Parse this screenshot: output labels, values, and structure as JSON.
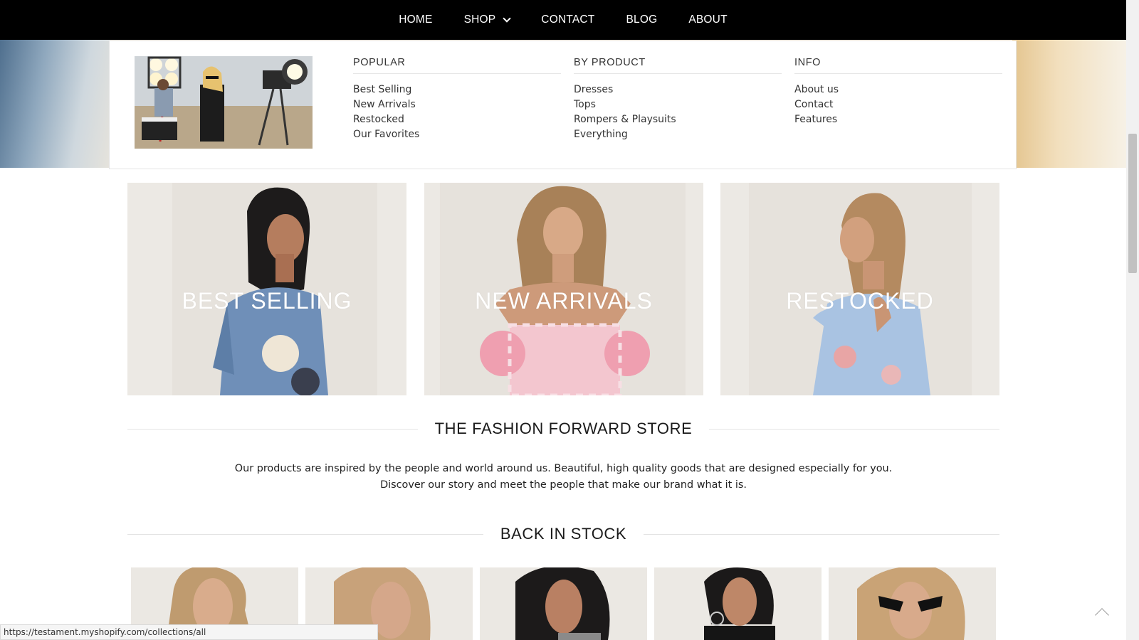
{
  "nav": {
    "items": [
      {
        "label": "HOME"
      },
      {
        "label": "SHOP",
        "has_dropdown": true
      },
      {
        "label": "CONTACT"
      },
      {
        "label": "BLOG"
      },
      {
        "label": "ABOUT"
      }
    ]
  },
  "mega_menu": {
    "columns": [
      {
        "heading": "POPULAR",
        "links": [
          "Best Selling",
          "New Arrivals",
          "Restocked",
          "Our Favorites"
        ]
      },
      {
        "heading": "BY PRODUCT",
        "links": [
          "Dresses",
          "Tops",
          "Rompers & Playsuits",
          "Everything"
        ]
      },
      {
        "heading": "INFO",
        "links": [
          "About us",
          "Contact",
          "Features"
        ]
      }
    ]
  },
  "collections": [
    {
      "label": "BEST SELLING"
    },
    {
      "label": "NEW ARRIVALS"
    },
    {
      "label": "RESTOCKED"
    }
  ],
  "about": {
    "title": "THE FASHION FORWARD STORE",
    "line1": "Our products are inspired by the people and world around us. Beautiful, high quality goods that are designed especially for you.",
    "line2": "Discover our story and meet the people that make our brand what it is."
  },
  "back_in_stock": {
    "title": "BACK IN STOCK"
  },
  "status_url": "https://testament.myshopify.com/collections/all",
  "colors": {
    "nav_bg": "#000000",
    "nav_text": "#ffffff",
    "tile_text": "#ffffff"
  }
}
